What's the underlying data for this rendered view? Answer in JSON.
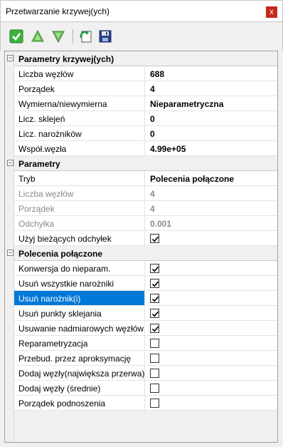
{
  "window": {
    "title": "Przetwarzanie krzywej(ych)",
    "close_glyph": "x"
  },
  "toolbar": {
    "buttons": [
      {
        "icon": "green-checkmark-icon"
      },
      {
        "icon": "up-triangle-icon"
      },
      {
        "icon": "down-triangle-icon"
      },
      {
        "icon": "refresh-icon"
      },
      {
        "icon": "save-icon"
      }
    ]
  },
  "sections": {
    "curve_params": {
      "title": "Parametry krzywej(ych)",
      "rows": [
        {
          "label": "Liczba węzłów",
          "value": "688"
        },
        {
          "label": "Porządek",
          "value": "4"
        },
        {
          "label": "Wymierna/niewymierna",
          "value": "Nieparametryczna"
        },
        {
          "label": "Licz. sklejeń",
          "value": "0"
        },
        {
          "label": "Licz. narożników",
          "value": "0"
        },
        {
          "label": "Współ.węzła",
          "value": "4.99e+05"
        }
      ]
    },
    "params": {
      "title": "Parametry",
      "rows": [
        {
          "label": "Tryb",
          "value": "Polecenia połączone"
        },
        {
          "label": "Liczba węzłów",
          "value": "4"
        },
        {
          "label": "Porządek",
          "value": "4"
        },
        {
          "label": "Odchyłka",
          "value": "0.001"
        },
        {
          "label": "Użyj bieżących odchyłek",
          "checked": true
        }
      ]
    },
    "combined": {
      "title": "Polecenia połączone",
      "rows": [
        {
          "label": "Konwersja do nieparam.",
          "checked": true
        },
        {
          "label": "Usuń wszystkie narożniki",
          "checked": true
        },
        {
          "label": "Usuń narożnik(i)",
          "checked": true,
          "selected": true
        },
        {
          "label": "Usuń punkty sklejania",
          "checked": true
        },
        {
          "label": "Usuwanie nadmiarowych węzłów",
          "checked": true
        },
        {
          "label": "Reparametryzacja",
          "checked": false
        },
        {
          "label": "Przebud. przez aproksymację",
          "checked": false
        },
        {
          "label": "Dodaj węzły(największa przerwa)",
          "checked": false
        },
        {
          "label": "Dodaj węzły (średnie)",
          "checked": false
        },
        {
          "label": "Porządek podnoszenia",
          "checked": false
        }
      ]
    }
  }
}
